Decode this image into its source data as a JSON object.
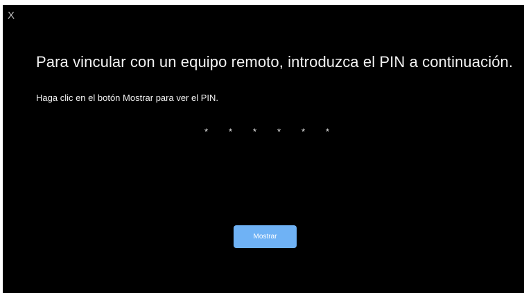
{
  "dialog": {
    "close_label": "X",
    "title": "Para vincular con un equipo remoto, introduzca el PIN a continuación.",
    "instruction": "Haga clic en el botón Mostrar para ver el PIN.",
    "pin_mask": [
      "*",
      "*",
      "*",
      "*",
      "*",
      "*"
    ],
    "show_button_label": "Mostrar"
  },
  "colors": {
    "background": "#000000",
    "button": "#6fb2f5",
    "text": "#f2f2f2"
  }
}
